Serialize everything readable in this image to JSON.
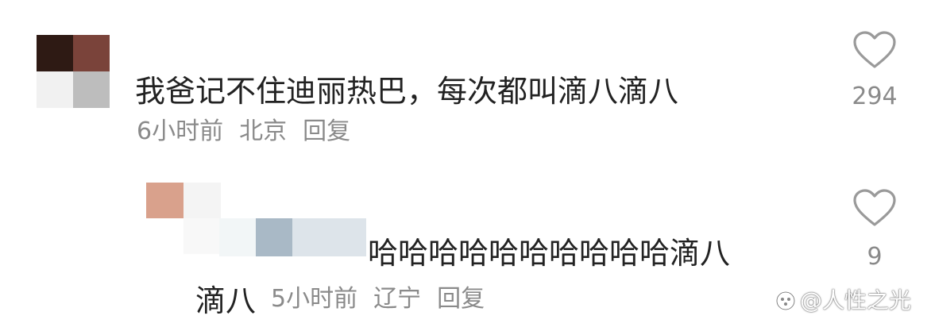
{
  "comments": [
    {
      "text": "我爸记不住迪丽热巴，每次都叫滴八滴八",
      "time": "6小时前",
      "location": "北京",
      "reply_label": "回复",
      "likes": "294"
    },
    {
      "text_line1": "哈哈哈哈哈哈哈哈哈哈滴八",
      "text_line2": "滴八",
      "time": "5小时前",
      "location": "辽宁",
      "reply_label": "回复",
      "likes": "9"
    }
  ],
  "watermark": "@人性之光",
  "icons": {
    "like": "heart-outline-icon",
    "watermark_logo": "circle-logo-icon"
  },
  "colors": {
    "text": "#222222",
    "meta": "#8a8a8a",
    "heart_stroke": "#9a9a9a"
  }
}
